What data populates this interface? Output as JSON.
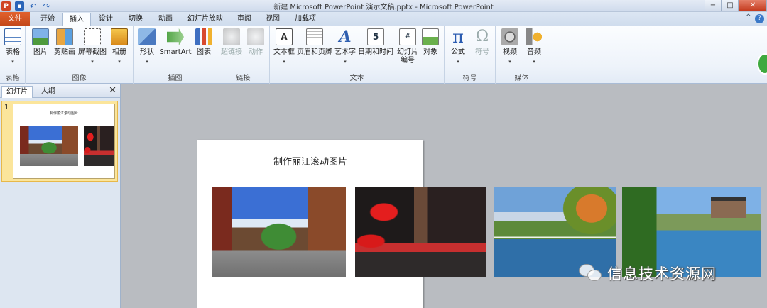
{
  "window": {
    "title": "新建 Microsoft PowerPoint 演示文稿.pptx - Microsoft PowerPoint",
    "app_logo": "P",
    "minimize": "−",
    "maximize": "□",
    "close": "✕"
  },
  "tabs": [
    {
      "label": "文件"
    },
    {
      "label": "开始"
    },
    {
      "label": "插入"
    },
    {
      "label": "设计"
    },
    {
      "label": "切换"
    },
    {
      "label": "动画"
    },
    {
      "label": "幻灯片放映"
    },
    {
      "label": "审阅"
    },
    {
      "label": "视图"
    },
    {
      "label": "加载项"
    }
  ],
  "ribbon": {
    "groups": {
      "tables": "表格",
      "images": "图像",
      "illustrations": "插图",
      "links": "链接",
      "text": "文本",
      "symbols": "符号",
      "media": "媒体"
    },
    "buttons": {
      "table": "表格",
      "picture": "图片",
      "clipart": "剪贴画",
      "screenshot": "屏幕截图",
      "album": "相册",
      "shapes": "形状",
      "smartart": "SmartArt",
      "chart": "图表",
      "hyperlink": "超链接",
      "action": "动作",
      "textbox": "文本框",
      "header_footer": "页眉和页脚",
      "wordart": "艺术字",
      "datetime": "日期和时间",
      "slide_number_1": "幻灯片",
      "slide_number_2": "编号",
      "object": "对象",
      "equation": "公式",
      "symbol": "符号",
      "video": "视频",
      "audio": "音频"
    },
    "icons": {
      "textbox": "A",
      "wordart": "A",
      "datetime": "5",
      "slide_number": "#",
      "equation": "π",
      "symbol": "Ω"
    }
  },
  "left_pane": {
    "tab_slides": "幻灯片",
    "tab_outline": "大纲",
    "close": "✕",
    "slide_number": "1",
    "thumb_title": "制作丽江滚动图片"
  },
  "slide": {
    "title": "制作丽江滚动图片"
  },
  "watermark": {
    "text": "信息技术资源网"
  },
  "colors": {
    "file_tab": "#c2471a",
    "ribbon_bg": "#eef3fa",
    "canvas_bg": "#b9bcc1",
    "selected_thumb": "#fbe59b"
  }
}
